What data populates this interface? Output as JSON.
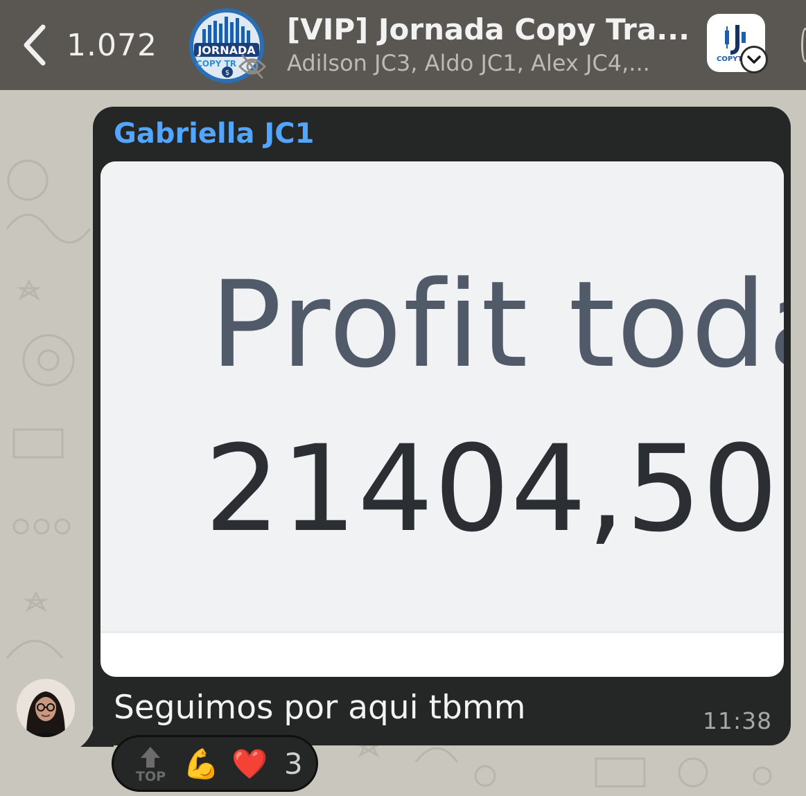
{
  "header": {
    "back_count": "1.072",
    "group_title": "[VIP] Jornada Copy Tra...",
    "group_subtitle": "Adilson JC3, Aldo JC1, Alex JC4,...",
    "group_avatar_text_line1": "JORNADA",
    "group_avatar_text_line2": "COPY TR",
    "app_badge_label": "COPYT"
  },
  "message": {
    "sender": "Gabriella JC1",
    "image_text_label": "Profit toda",
    "image_text_value": "21404,50",
    "caption": "Seguimos por aqui tbmm",
    "time": "11:38"
  },
  "reactions": {
    "top_label": "TOP",
    "emojis": [
      "💪",
      "❤️"
    ],
    "count": "3"
  },
  "colors": {
    "header_bg": "#5a5752",
    "bubble_bg": "#252626",
    "sender_name": "#53a6ff",
    "chat_bg": "#c9c6bd"
  },
  "icons": {
    "back": "chevron-left-icon",
    "dropdown": "chevron-down-icon",
    "hidden": "eye-slash-icon",
    "top": "arrow-up-icon"
  }
}
